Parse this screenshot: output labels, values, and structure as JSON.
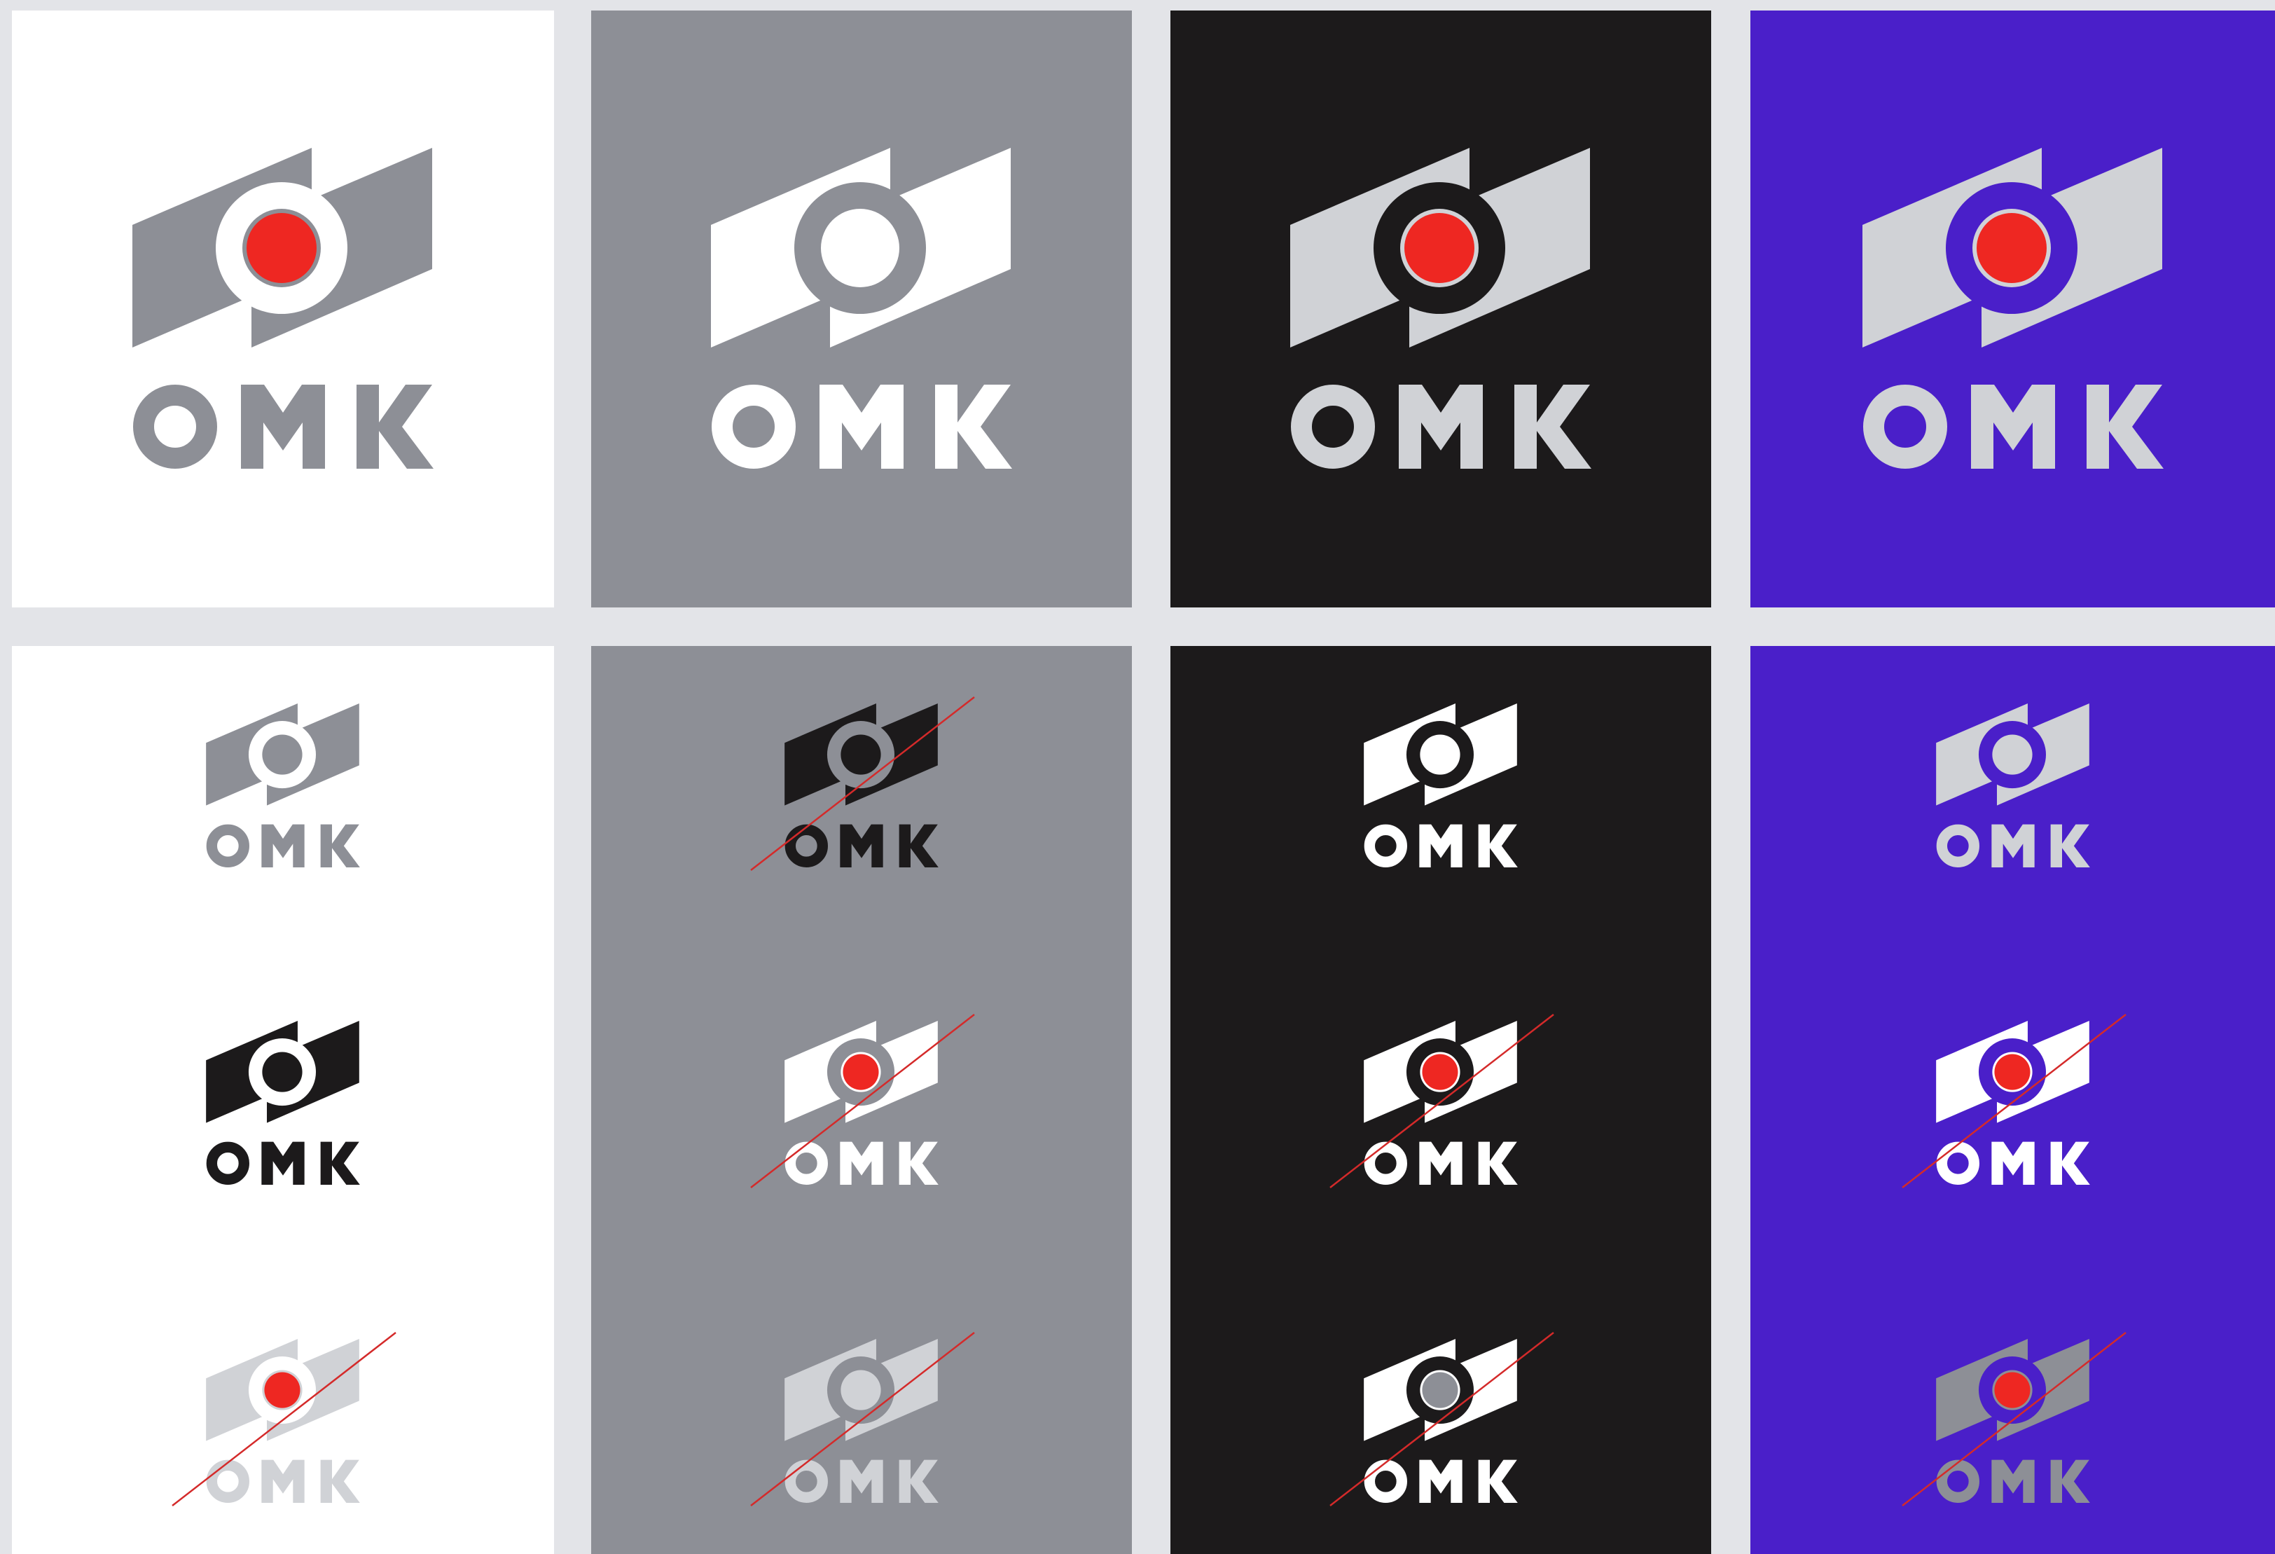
{
  "brand": {
    "wordmark": "OMK"
  },
  "backgrounds": {
    "white": "#ffffff",
    "grey": "#8d8f96",
    "black": "#1c1a1b",
    "blue": "#4a1fc9",
    "page": "#e3e4e8"
  },
  "accent": {
    "red": "#ee2722",
    "strike": "#d42a2a"
  },
  "logos": [
    {
      "id": "top-white",
      "panel": "white",
      "status": "main",
      "shapes": "#8d8f96",
      "ring": "#ffffff",
      "dot": "#ee2722",
      "text": "#8d8f96",
      "crossed": false
    },
    {
      "id": "top-grey",
      "panel": "grey",
      "status": "main",
      "shapes": "#ffffff",
      "ring": "#8d8f96",
      "dot": "#ffffff",
      "text": "#ffffff",
      "crossed": false
    },
    {
      "id": "top-black",
      "panel": "black",
      "status": "main",
      "shapes": "#d0d2d6",
      "ring": "#1c1a1b",
      "dot": "#ee2722",
      "text": "#d0d2d6",
      "crossed": false
    },
    {
      "id": "top-blue",
      "panel": "blue",
      "status": "main",
      "shapes": "#d0d2d6",
      "ring": "#4a1fc9",
      "dot": "#ee2722",
      "text": "#d0d2d6",
      "crossed": false
    },
    {
      "id": "white-1",
      "panel": "white",
      "status": "allowed",
      "shapes": "#8d8f96",
      "ring": "#ffffff",
      "dot": "#8d8f96",
      "text": "#8d8f96",
      "crossed": false
    },
    {
      "id": "white-2",
      "panel": "white",
      "status": "allowed",
      "shapes": "#1c1a1b",
      "ring": "#ffffff",
      "dot": "#1c1a1b",
      "text": "#1c1a1b",
      "crossed": false
    },
    {
      "id": "white-3",
      "panel": "white",
      "status": "forbidden",
      "shapes": "#d0d2d6",
      "ring": "#ffffff",
      "dot": "#ee2722",
      "text": "#d0d2d6",
      "crossed": true
    },
    {
      "id": "grey-1",
      "panel": "grey",
      "status": "forbidden",
      "shapes": "#1c1a1b",
      "ring": "#8d8f96",
      "dot": "#1c1a1b",
      "text": "#1c1a1b",
      "crossed": true
    },
    {
      "id": "grey-2",
      "panel": "grey",
      "status": "forbidden",
      "shapes": "#ffffff",
      "ring": "#8d8f96",
      "dot": "#ee2722",
      "text": "#ffffff",
      "crossed": true
    },
    {
      "id": "grey-3",
      "panel": "grey",
      "status": "forbidden",
      "shapes": "#d0d2d6",
      "ring": "#8d8f96",
      "dot": "#d0d2d6",
      "text": "#d0d2d6",
      "crossed": true
    },
    {
      "id": "black-1",
      "panel": "black",
      "status": "allowed",
      "shapes": "#ffffff",
      "ring": "#1c1a1b",
      "dot": "#ffffff",
      "text": "#ffffff",
      "crossed": false
    },
    {
      "id": "black-2",
      "panel": "black",
      "status": "forbidden",
      "shapes": "#ffffff",
      "ring": "#1c1a1b",
      "dot": "#ee2722",
      "text": "#ffffff",
      "crossed": true
    },
    {
      "id": "black-3",
      "panel": "black",
      "status": "forbidden",
      "shapes": "#ffffff",
      "ring": "#1c1a1b",
      "dot": "#8d8f96",
      "text": "#ffffff",
      "crossed": true
    },
    {
      "id": "blue-1",
      "panel": "blue",
      "status": "allowed",
      "shapes": "#d0d2d6",
      "ring": "#4a1fc9",
      "dot": "#d0d2d6",
      "text": "#d0d2d6",
      "crossed": false
    },
    {
      "id": "blue-2",
      "panel": "blue",
      "status": "forbidden",
      "shapes": "#ffffff",
      "ring": "#4a1fc9",
      "dot": "#ee2722",
      "text": "#ffffff",
      "crossed": true
    },
    {
      "id": "blue-3",
      "panel": "blue",
      "status": "forbidden",
      "shapes": "#8d8f96",
      "ring": "#4a1fc9",
      "dot": "#ee2722",
      "text": "#8d8f96",
      "crossed": true
    }
  ]
}
